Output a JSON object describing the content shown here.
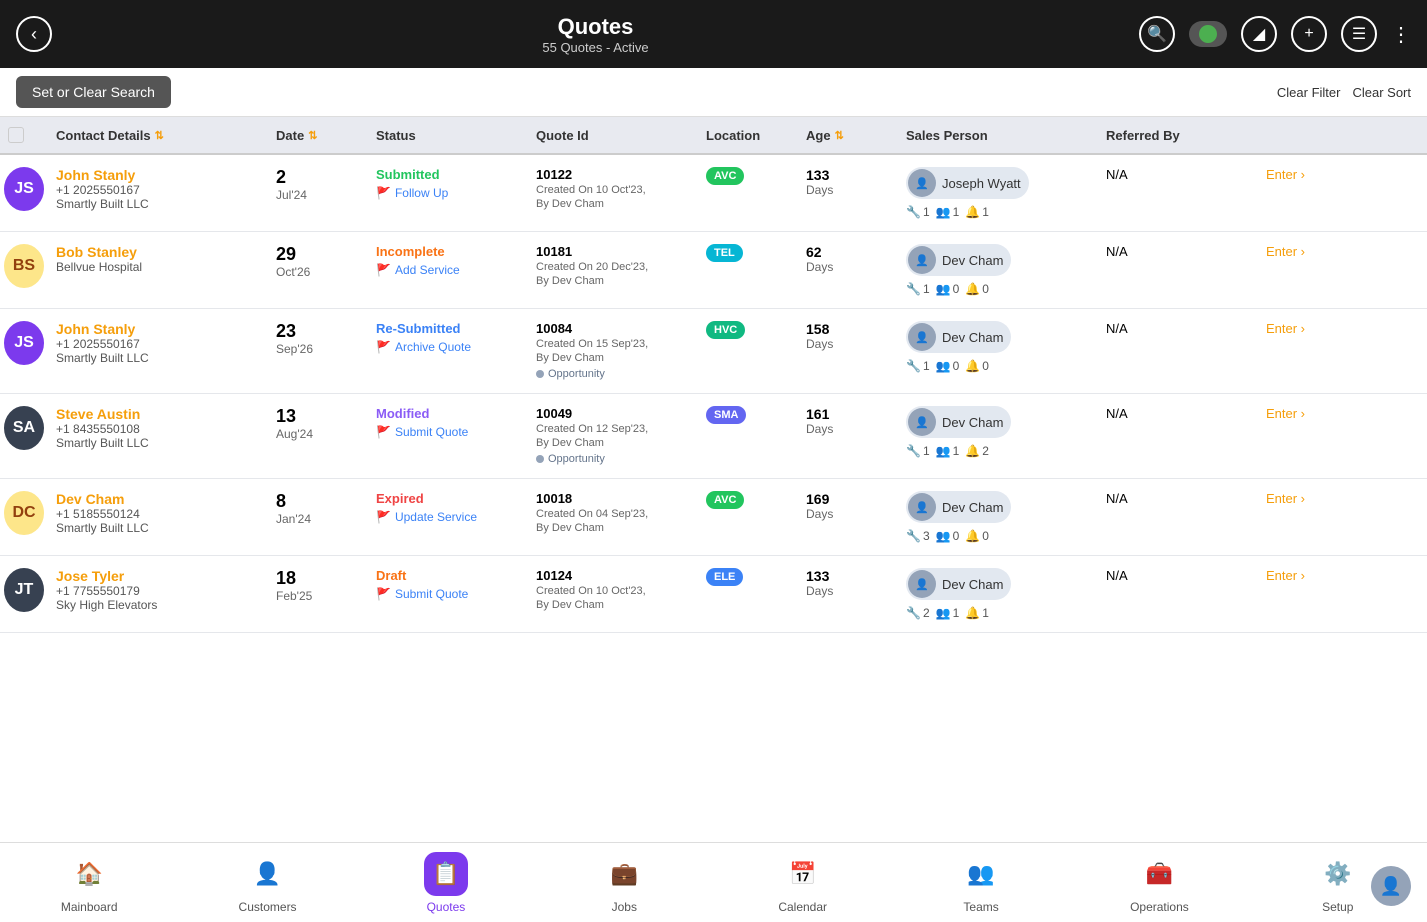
{
  "header": {
    "title": "Quotes",
    "subtitle": "55 Quotes - Active",
    "back_label": "‹",
    "icons": [
      "search",
      "toggle",
      "filter",
      "add",
      "list",
      "more"
    ]
  },
  "toolbar": {
    "set_clear_label": "Set or Clear Search",
    "clear_filter_label": "Clear Filter",
    "clear_sort_label": "Clear Sort"
  },
  "table": {
    "columns": [
      "",
      "Contact Details",
      "Date",
      "Status",
      "Quote Id",
      "Location",
      "Age",
      "Sales Person",
      "Referred By",
      ""
    ],
    "rows": [
      {
        "id": "row-john-stanly-1",
        "avatar_type": "image",
        "avatar_bg": "#7c3aed",
        "avatar_initials": "JS",
        "name": "John Stanly",
        "phone": "+1 2025550167",
        "company": "Smartly Built LLC",
        "date_num": "2",
        "date_label": "Jul'24",
        "status": "Submitted",
        "status_class": "status-submitted",
        "action": "Follow Up",
        "quote_id": "10122",
        "quote_created": "Created On 10 Oct'23,",
        "quote_by": "By Dev Cham",
        "location": "AVC",
        "location_class": "badge-avc",
        "age_num": "133",
        "age_label": "Days",
        "sales_person": "Joseph Wyatt",
        "icon1": "🔧",
        "count1": "1",
        "icon2": "👥",
        "count2": "1",
        "icon3": "🔔",
        "count3": "1",
        "referred_by": "N/A",
        "opportunity": false
      },
      {
        "id": "row-bob-stanley",
        "avatar_type": "initials",
        "avatar_bg": "#fde68a",
        "avatar_color": "#92400e",
        "avatar_initials": "BS",
        "name": "Bob Stanley",
        "phone": "",
        "company": "Bellvue Hospital",
        "date_num": "29",
        "date_label": "Oct'26",
        "status": "Incomplete",
        "status_class": "status-incomplete",
        "action": "Add Service",
        "quote_id": "10181",
        "quote_created": "Created On 20 Dec'23,",
        "quote_by": "By Dev Cham",
        "location": "TEL",
        "location_class": "badge-tel",
        "age_num": "62",
        "age_label": "Days",
        "sales_person": "Dev Cham",
        "icon1": "🔧",
        "count1": "1",
        "icon2": "👥",
        "count2": "0",
        "icon3": "🔔",
        "count3": "0",
        "referred_by": "N/A",
        "opportunity": false
      },
      {
        "id": "row-john-stanly-2",
        "avatar_type": "image",
        "avatar_bg": "#7c3aed",
        "avatar_initials": "JS",
        "name": "John Stanly",
        "phone": "+1 2025550167",
        "company": "Smartly Built LLC",
        "date_num": "23",
        "date_label": "Sep'26",
        "status": "Re-Submitted",
        "status_class": "status-resubmitted",
        "action": "Archive Quote",
        "quote_id": "10084",
        "quote_created": "Created On 15 Sep'23,",
        "quote_by": "By Dev Cham",
        "location": "HVC",
        "location_class": "badge-hvc",
        "age_num": "158",
        "age_label": "Days",
        "sales_person": "Dev Cham",
        "icon1": "🔧",
        "count1": "1",
        "icon2": "👥",
        "count2": "0",
        "icon3": "🔔",
        "count3": "0",
        "referred_by": "N/A",
        "opportunity": true
      },
      {
        "id": "row-steve-austin",
        "avatar_type": "image",
        "avatar_bg": "#374151",
        "avatar_initials": "SA",
        "name": "Steve Austin",
        "phone": "+1 8435550108",
        "company": "Smartly Built LLC",
        "date_num": "13",
        "date_label": "Aug'24",
        "status": "Modified",
        "status_class": "status-modified",
        "action": "Submit Quote",
        "quote_id": "10049",
        "quote_created": "Created On 12 Sep'23,",
        "quote_by": "By Dev Cham",
        "location": "SMA",
        "location_class": "badge-sma",
        "age_num": "161",
        "age_label": "Days",
        "sales_person": "Dev Cham",
        "icon1": "🔧",
        "count1": "1",
        "icon2": "👥",
        "count2": "1",
        "icon3": "🔔",
        "count3": "2",
        "referred_by": "N/A",
        "opportunity": true
      },
      {
        "id": "row-dev-cham",
        "avatar_type": "initials",
        "avatar_bg": "#fde68a",
        "avatar_color": "#92400e",
        "avatar_initials": "DC",
        "name": "Dev Cham",
        "phone": "+1 5185550124",
        "company": "Smartly Built LLC",
        "date_num": "8",
        "date_label": "Jan'24",
        "status": "Expired",
        "status_class": "status-expired",
        "action": "Update Service",
        "quote_id": "10018",
        "quote_created": "Created On 04 Sep'23,",
        "quote_by": "By Dev Cham",
        "location": "AVC",
        "location_class": "badge-avc",
        "age_num": "169",
        "age_label": "Days",
        "sales_person": "Dev Cham",
        "icon1": "🔧",
        "count1": "3",
        "icon2": "👥",
        "count2": "0",
        "icon3": "🔔",
        "count3": "0",
        "referred_by": "N/A",
        "opportunity": false
      },
      {
        "id": "row-jose-tyler",
        "avatar_type": "image",
        "avatar_bg": "#374151",
        "avatar_initials": "JT",
        "name": "Jose Tyler",
        "phone": "+1 7755550179",
        "company": "Sky High Elevators",
        "date_num": "18",
        "date_label": "Feb'25",
        "status": "Draft",
        "status_class": "status-draft",
        "action": "Submit Quote",
        "quote_id": "10124",
        "quote_created": "Created On 10 Oct'23,",
        "quote_by": "By Dev Cham",
        "location": "ELE",
        "location_class": "badge-ele",
        "age_num": "133",
        "age_label": "Days",
        "sales_person": "Dev Cham",
        "icon1": "🔧",
        "count1": "2",
        "icon2": "👥",
        "count2": "1",
        "icon3": "🔔",
        "count3": "1",
        "referred_by": "N/A",
        "opportunity": false
      }
    ]
  },
  "bottom_nav": {
    "items": [
      {
        "id": "mainboard",
        "label": "Mainboard",
        "icon": "🏠",
        "color": "#f59e0b",
        "active": false
      },
      {
        "id": "customers",
        "label": "Customers",
        "icon": "👤",
        "color": "#22c55e",
        "active": false
      },
      {
        "id": "quotes",
        "label": "Quotes",
        "icon": "📋",
        "color": "#7c3aed",
        "active": true
      },
      {
        "id": "jobs",
        "label": "Jobs",
        "icon": "💼",
        "color": "#ef4444",
        "active": false
      },
      {
        "id": "calendar",
        "label": "Calendar",
        "icon": "📅",
        "color": "#f59e0b",
        "active": false
      },
      {
        "id": "teams",
        "label": "Teams",
        "icon": "👥",
        "color": "#06b6d4",
        "active": false
      },
      {
        "id": "operations",
        "label": "Operations",
        "icon": "🧰",
        "color": "#ef4444",
        "active": false
      },
      {
        "id": "setup",
        "label": "Setup",
        "icon": "⚙️",
        "color": "#94a3b8",
        "active": false
      }
    ]
  }
}
